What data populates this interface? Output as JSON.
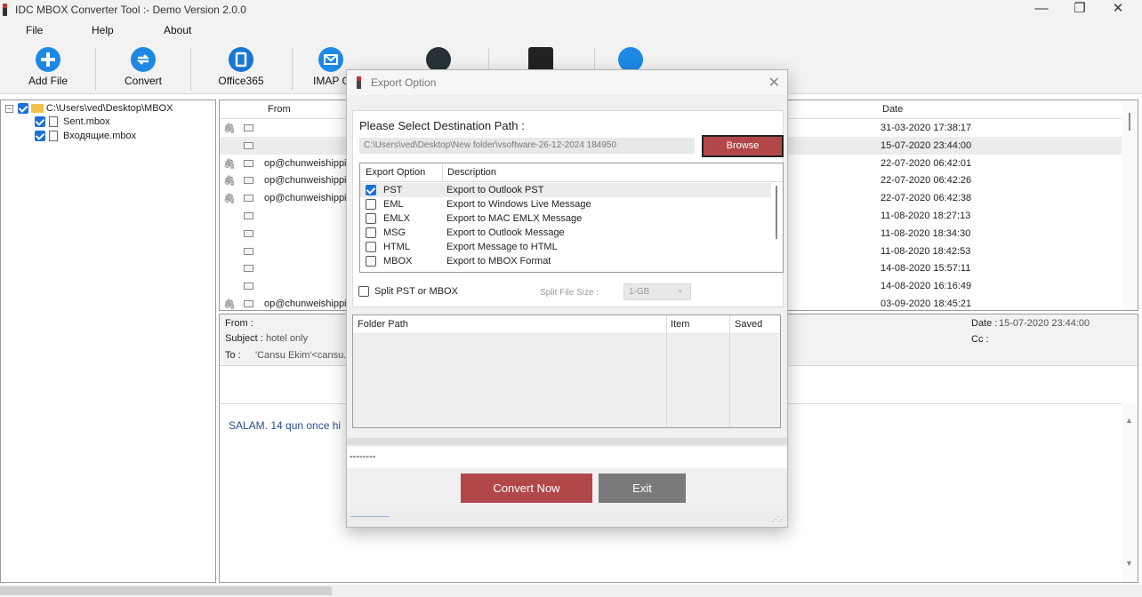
{
  "window": {
    "title": "IDC MBOX Converter Tool  :- Demo Version 2.0.0",
    "minimize": "—",
    "restore": "❐",
    "close": "✕"
  },
  "menu": [
    "File",
    "Help",
    "About"
  ],
  "toolbar": {
    "add_file": "Add File",
    "convert": "Convert",
    "office365": "Office365",
    "imap": "IMAP G"
  },
  "tree": {
    "root": "C:\\Users\\ved\\Desktop\\MBOX",
    "items": [
      "Sent.mbox",
      "Входящие.mbox"
    ]
  },
  "mail_list": {
    "columns": {
      "from": "From",
      "date": "Date"
    },
    "rows": [
      {
        "attach": true,
        "from": "",
        "date": "31-03-2020 17:38:17"
      },
      {
        "attach": false,
        "from": "",
        "date": "15-07-2020 23:44:00"
      },
      {
        "attach": true,
        "from": "op@chunweishipping",
        "date": "22-07-2020 06:42:01"
      },
      {
        "attach": true,
        "from": "op@chunweishipping",
        "date": "22-07-2020 06:42:26"
      },
      {
        "attach": true,
        "from": "op@chunweishipping",
        "date": "22-07-2020 06:42:38"
      },
      {
        "attach": false,
        "from": "",
        "date": "11-08-2020 18:27:13"
      },
      {
        "attach": false,
        "from": "",
        "date": "11-08-2020 18:34:30"
      },
      {
        "attach": false,
        "from": "",
        "date": "11-08-2020 18:42:53"
      },
      {
        "attach": false,
        "from": "",
        "date": "14-08-2020 15:57:11"
      },
      {
        "attach": false,
        "from": "",
        "date": "14-08-2020 16:16:49"
      },
      {
        "attach": true,
        "from": "op@chunweishipping",
        "date": "03-09-2020 18:45:21"
      }
    ]
  },
  "preview": {
    "from_label": "From :",
    "subject_label": "Subject :",
    "subject_value": "hotel only",
    "to_label": "To :",
    "to_value": "'Cansu Ekim'<cansu.ek",
    "date_label": "Date :",
    "date_value": "15-07-2020 23:44:00",
    "cc_label": "Cc :",
    "body": "SALAM. 14 qun once hi"
  },
  "dialog": {
    "title": "Export Option",
    "dest_title": "Please Select Destination Path :",
    "path": "C:\\Users\\ved\\Desktop\\New folder\\vsoftware-26-12-2024 184950",
    "browse": "Browse",
    "options_header": {
      "option": "Export Option",
      "description": "Description"
    },
    "options": [
      {
        "name": "PST",
        "description": "Export to Outlook PST",
        "checked": true
      },
      {
        "name": "EML",
        "description": "Export to Windows Live Message",
        "checked": false
      },
      {
        "name": "EMLX",
        "description": "Export to MAC EMLX Message",
        "checked": false
      },
      {
        "name": "MSG",
        "description": "Export to Outlook Message",
        "checked": false
      },
      {
        "name": "HTML",
        "description": "Export Message to HTML",
        "checked": false
      },
      {
        "name": "MBOX",
        "description": "Export to MBOX Format",
        "checked": false
      }
    ],
    "split_label": "Split PST or MBOX",
    "split_size_label": "Split File Size :",
    "split_size_value": "1-GB",
    "result_columns": {
      "folder_path": "Folder Path",
      "item": "Item",
      "saved": "Saved"
    },
    "status": "--------",
    "convert_now": "Convert Now",
    "exit": "Exit"
  },
  "colors": {
    "accent_blue": "#1e88e5",
    "office_blue": "#1976d2",
    "button_red": "#b2474a",
    "exit_gray": "#7a7a7a"
  }
}
